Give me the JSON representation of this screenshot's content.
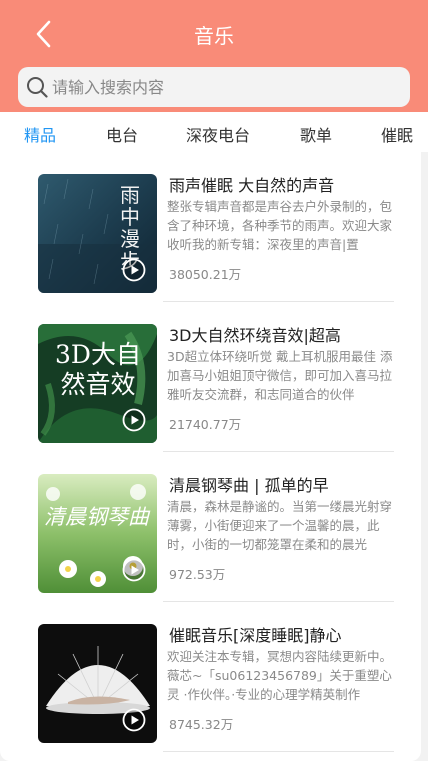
{
  "header": {
    "title": "音乐"
  },
  "search": {
    "placeholder": "请输入搜索内容"
  },
  "tabs": [
    {
      "label": "精品",
      "active": true
    },
    {
      "label": "电台",
      "active": false
    },
    {
      "label": "深夜电台",
      "active": false
    },
    {
      "label": "歌单",
      "active": false
    },
    {
      "label": "催眠",
      "active": false
    }
  ],
  "items": [
    {
      "title": "雨声催眠 大自然的声音",
      "desc": "整张专辑声音都是声谷去户外录制的，包含了种环境，各种季节的雨声。欢迎大家收听我的新专辑：深夜里的声音|置",
      "count": "38050.21万",
      "cover_text": "雨中漫步"
    },
    {
      "title": "3D大自然环绕音效|超高",
      "desc": "3D超立体环绕听觉 戴上耳机服用最佳 添加喜马小姐姐顶守微信，即可加入喜马拉雅听友交流群，和志同道合的伙伴",
      "count": "21740.77万",
      "cover_text": "3D大自然音效"
    },
    {
      "title": "清晨钢琴曲 | 孤单的早",
      "desc": "清晨，森林是静谧的。当第一缕晨光射穿薄雾，小街便迎来了一个温馨的晨，此时，小街的一切都笼罩在柔和的晨光",
      "count": "972.53万",
      "cover_text": "清晨钢琴曲"
    },
    {
      "title": "催眠音乐[深度睡眠]静心",
      "desc": "欢迎关注本专辑，冥想内容陆续更新中。薇芯~「su06123456789」关于重塑心灵 ·作伙伴。·专业的心理学精英制作",
      "count": "8745.32万",
      "cover_text": ""
    }
  ],
  "colors": {
    "accent": "#f98b78",
    "tab_active": "#2196f3"
  }
}
